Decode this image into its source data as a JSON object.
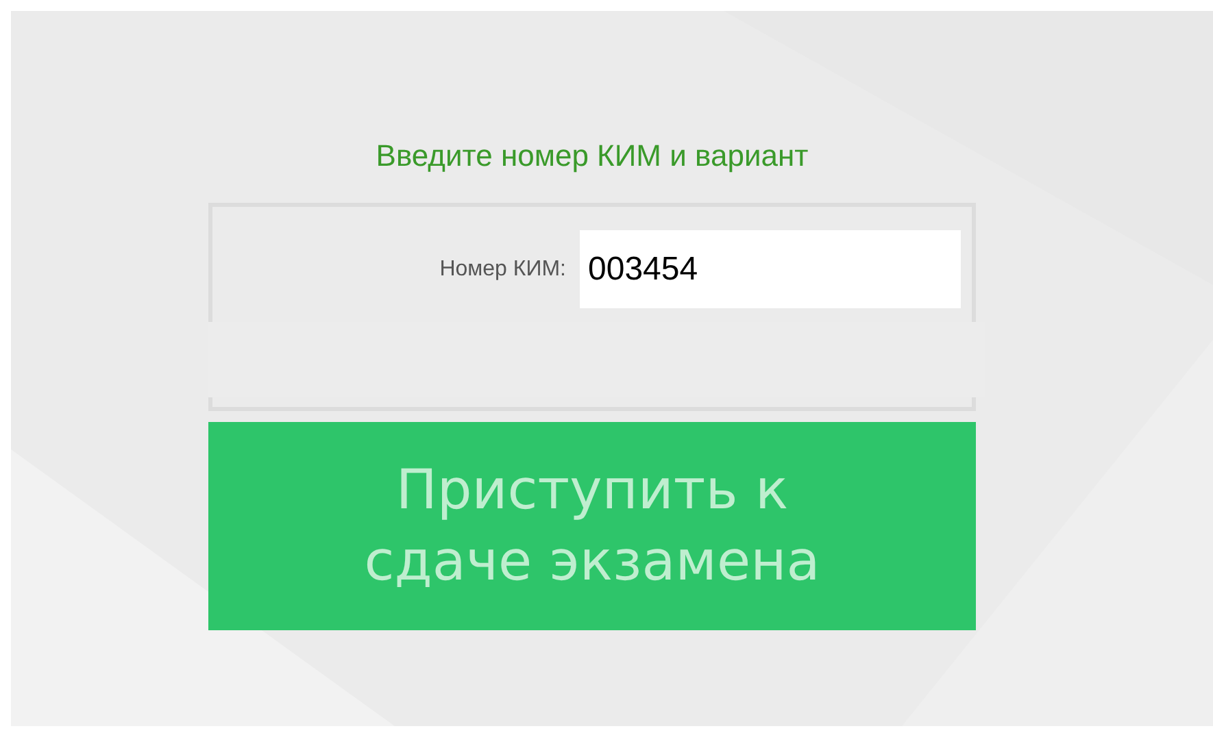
{
  "heading": "Введите номер КИМ и вариант",
  "fields": [
    {
      "label": "Номер КИМ:",
      "value": "003454"
    }
  ],
  "button": {
    "label": "Приступить к сдаче экзамена"
  }
}
